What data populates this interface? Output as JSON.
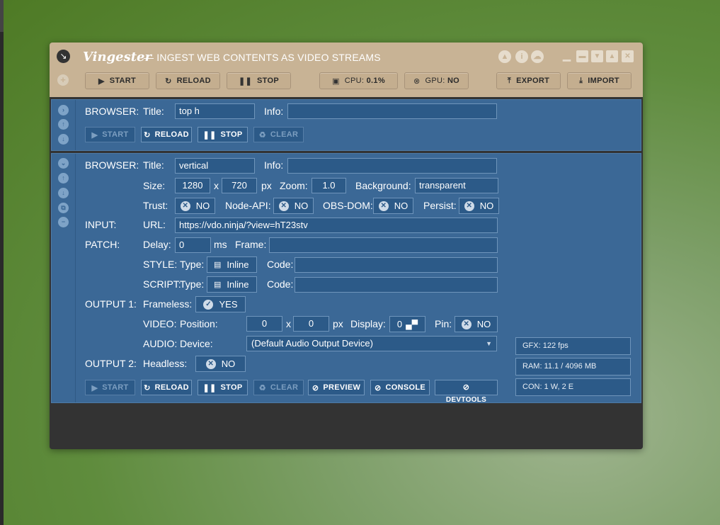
{
  "header": {
    "app_name": "Vingester",
    "app_desc": "— INGEST WEB CONTENTS AS VIDEO STREAMS",
    "buttons": {
      "start": "START",
      "reload": "RELOAD",
      "stop": "STOP",
      "export": "EXPORT",
      "import": "IMPORT"
    },
    "cpu_label": "CPU:",
    "cpu_value": "0.1%",
    "gpu_label": "GPU:",
    "gpu_value": "NO"
  },
  "browser1": {
    "section": "BROWSER:",
    "title_label": "Title:",
    "title_value": "top h",
    "info_label": "Info:",
    "info_value": "",
    "buttons": {
      "start": "START",
      "reload": "RELOAD",
      "stop": "STOP",
      "clear": "CLEAR"
    }
  },
  "browser2": {
    "section": "BROWSER:",
    "title_label": "Title:",
    "title_value": "vertical",
    "info_label": "Info:",
    "info_value": "",
    "size_label": "Size:",
    "width": "1280",
    "x_sep": "x",
    "height": "720",
    "px_unit": "px",
    "zoom_label": "Zoom:",
    "zoom": "1.0",
    "background_label": "Background:",
    "background": "transparent",
    "trust_label": "Trust:",
    "trust": "NO",
    "node_api_label": "Node-API:",
    "node_api": "NO",
    "obs_dom_label": "OBS-DOM:",
    "obs_dom": "NO",
    "persist_label": "Persist:",
    "persist": "NO",
    "input_section": "INPUT:",
    "url_label": "URL:",
    "url": "https://vdo.ninja/?view=hT23stv",
    "patch_section": "PATCH:",
    "delay_label": "Delay:",
    "delay": "0",
    "ms_unit": "ms",
    "frame_label": "Frame:",
    "frame": "",
    "style_label": "STYLE:",
    "type_label": "Type:",
    "style_type": "Inline",
    "code_label": "Code:",
    "style_code": "",
    "script_label": "SCRIPT:",
    "script_type": "Inline",
    "script_code": "",
    "output1_section": "OUTPUT 1:",
    "frameless_label": "Frameless:",
    "frameless": "YES",
    "video_label": "VIDEO:",
    "position_label": "Position:",
    "pos_x": "0",
    "pos_y": "0",
    "display_label": "Display:",
    "display": "0",
    "pin_label": "Pin:",
    "pin": "NO",
    "audio_label": "AUDIO:",
    "device_label": "Device:",
    "device": "(Default Audio Output Device)",
    "output2_section": "OUTPUT 2:",
    "headless_label": "Headless:",
    "headless": "NO",
    "buttons": {
      "start": "START",
      "reload": "RELOAD",
      "stop": "STOP",
      "clear": "CLEAR",
      "preview": "PREVIEW",
      "console": "CONSOLE",
      "devtools": "DEVTOOLS"
    },
    "stats": {
      "gfx": "GFX:   122 fps",
      "ram": "RAM:   11.1 / 4096 MB",
      "con": "CON:   1 W, 2 E"
    }
  }
}
